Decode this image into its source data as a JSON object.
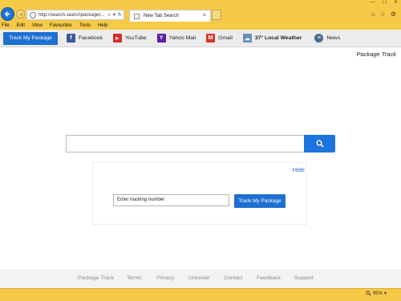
{
  "window": {
    "controls": [
      "—",
      "☐",
      "✕"
    ]
  },
  "browser": {
    "url": "http://search.searchpackaget...",
    "tab_title": "New Tab Search",
    "tab_close": "×",
    "address_icons": [
      "⌕",
      "▾",
      "↻"
    ],
    "right_icons": [
      "⌂",
      "☆",
      "⚙"
    ]
  },
  "menu": [
    "File",
    "Edit",
    "View",
    "Favourites",
    "Tools",
    "Help"
  ],
  "toolbar": {
    "track_button": "Track My Package",
    "links": [
      {
        "label": "Facebook",
        "icon": "facebook-icon",
        "glyph": "f",
        "color": "#3b5998"
      },
      {
        "label": "YouTube",
        "icon": "youtube-icon",
        "glyph": "▶",
        "color": "#d62b2b"
      },
      {
        "label": "Yahoo Mail",
        "icon": "yahoo-icon",
        "glyph": "Y",
        "color": "#5f1ea3"
      },
      {
        "label": "Gmail",
        "icon": "gmail-icon",
        "glyph": "M",
        "color": "#d9372b"
      },
      {
        "label": "37° Local Weather",
        "icon": "weather-icon",
        "glyph": "☁",
        "color": "#6b8fb5"
      },
      {
        "label": "News",
        "icon": "news-icon",
        "glyph": "≡",
        "color": "#4d6a8c"
      }
    ]
  },
  "page": {
    "brand": "Package Track",
    "search_placeholder": "",
    "hide_link": "Hide",
    "tracking_placeholder": "Enter tracking number",
    "track_button": "Track My Package"
  },
  "footer": {
    "links": [
      "Package Track",
      "Terms",
      "Privacy",
      "Uninstall",
      "Contact",
      "Feedback",
      "Support"
    ]
  },
  "status": {
    "zoom": "95%"
  },
  "colors": {
    "chrome": "#f7c948",
    "accent": "#1f6fd1"
  }
}
